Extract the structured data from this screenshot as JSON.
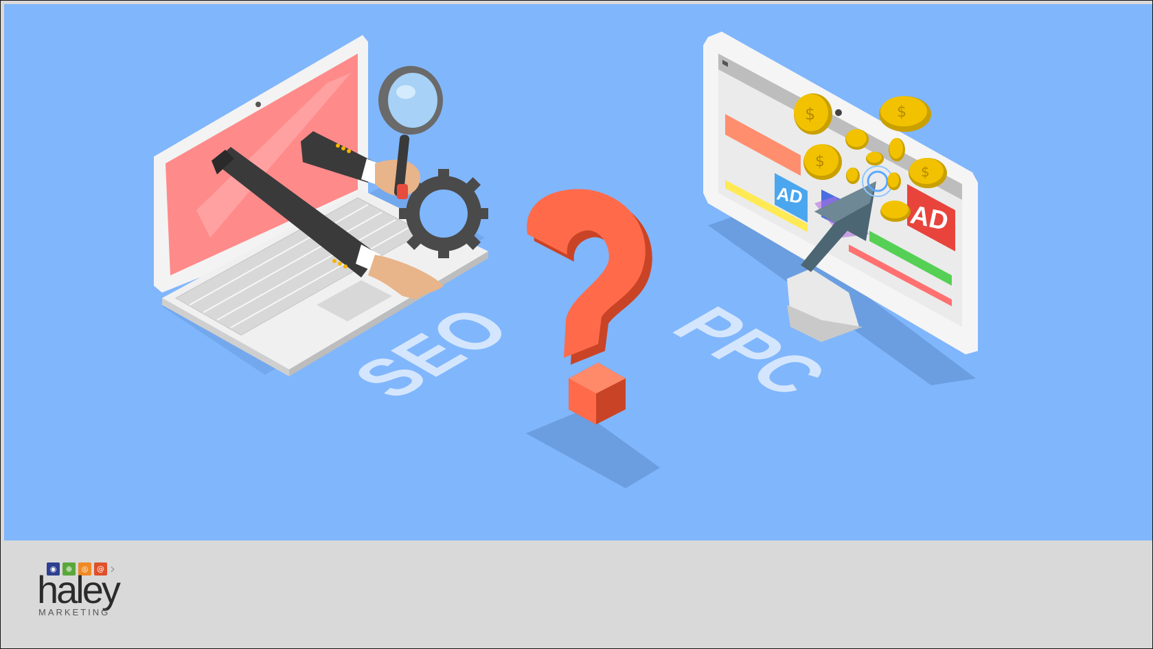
{
  "hero": {
    "label_seo": "SEO",
    "label_ppc": "PPC",
    "ad_label_small": "AD",
    "ad_label_large": "AD",
    "coin_symbol": "$",
    "colors": {
      "background": "#80b6fc",
      "question_mark": "#ff6b4a",
      "laptop_screen": "#ff8a8a",
      "label_text": "#d4e6fd"
    }
  },
  "logo": {
    "word": "haley",
    "sub": "MARKETING",
    "icons": [
      "globe-icon",
      "world-icon",
      "fingerprint-icon",
      "at-icon"
    ],
    "icon_colors": [
      "#2d3f8f",
      "#5aa83c",
      "#f08a24",
      "#e0502a"
    ]
  }
}
